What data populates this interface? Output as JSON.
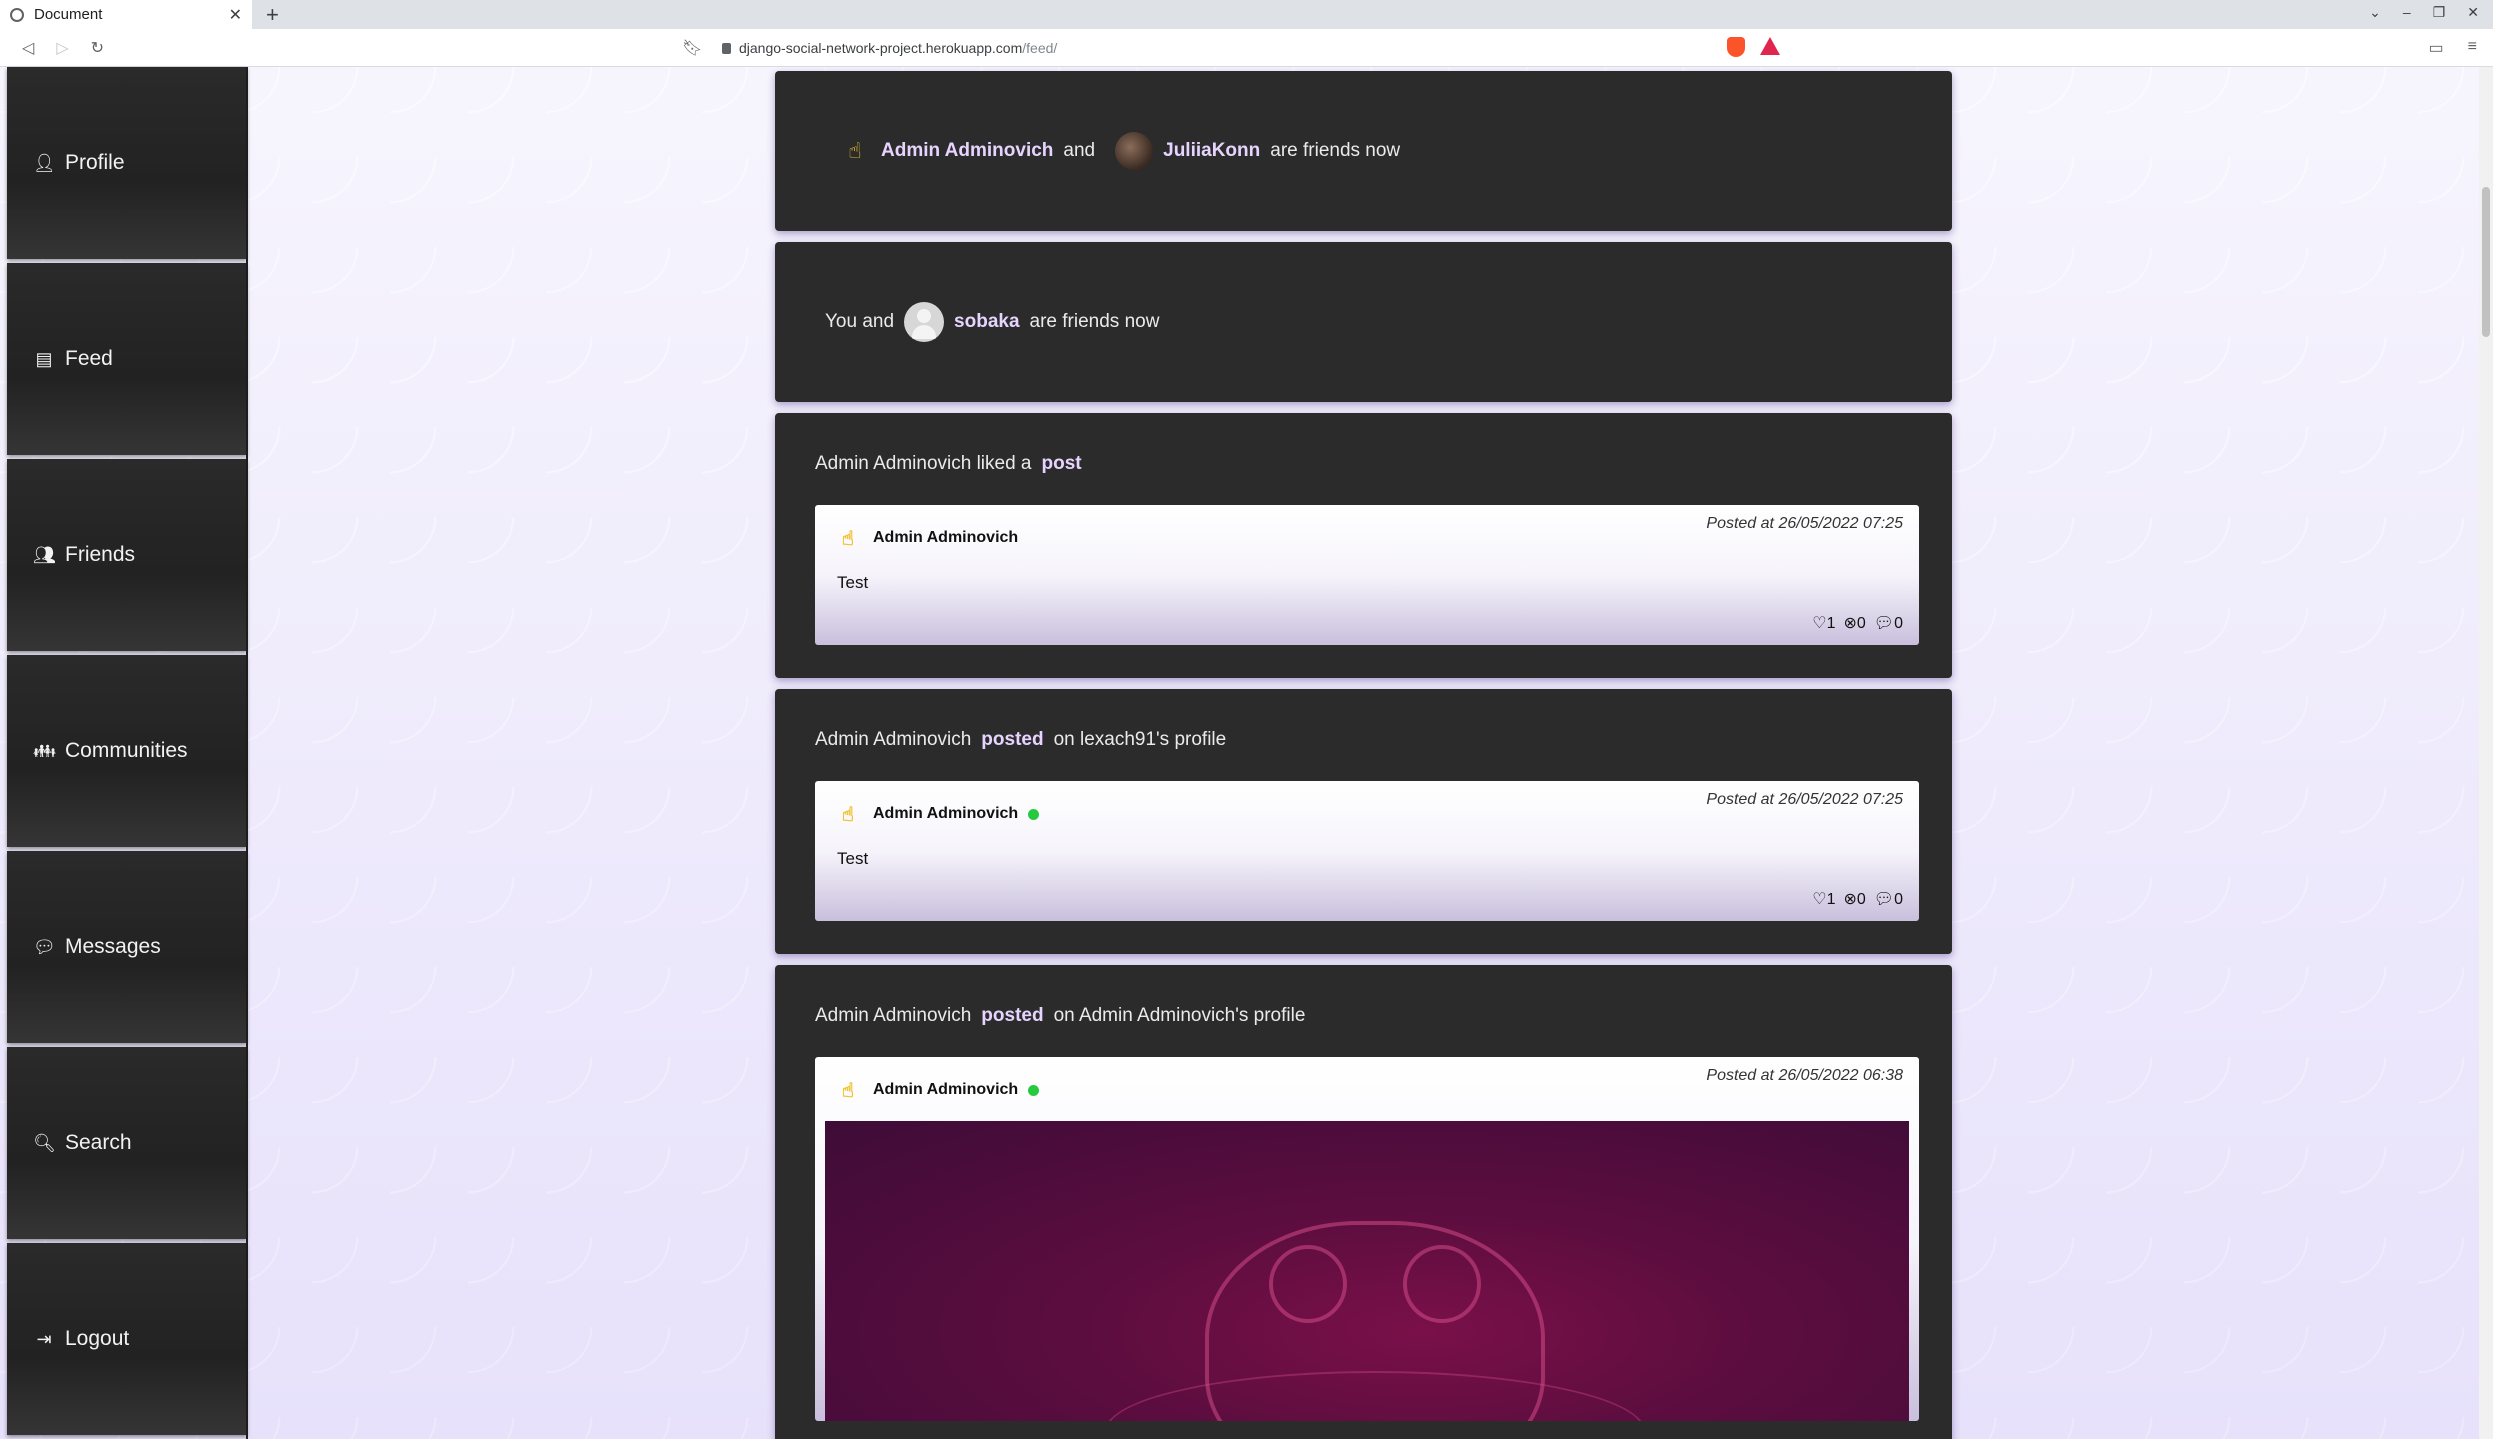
{
  "browser": {
    "tab_title": "Document",
    "url_host": "django-social-network-project.herokuapp.com",
    "url_path": "/feed/"
  },
  "sidebar": {
    "items": [
      {
        "label": "Profile",
        "icon": "user-icon"
      },
      {
        "label": "Feed",
        "icon": "newspaper-icon"
      },
      {
        "label": "Friends",
        "icon": "friends-icon"
      },
      {
        "label": "Communities",
        "icon": "communities-icon"
      },
      {
        "label": "Messages",
        "icon": "messages-icon"
      },
      {
        "label": "Search",
        "icon": "search-icon"
      },
      {
        "label": "Logout",
        "icon": "logout-icon"
      }
    ]
  },
  "feed": {
    "friendship1": {
      "user1": "Admin Adminovich",
      "and": "and",
      "user2": "JuliiaKonn",
      "suffix": "are friends now"
    },
    "friendship2": {
      "prefix": "You and",
      "user": "sobaka",
      "suffix": "are friends now"
    },
    "activity1": {
      "head_text": "Admin Adminovich liked a",
      "head_link": "post",
      "post": {
        "time": "Posted at 26/05/2022 07:25",
        "author": "Admin Adminovich",
        "text": "Test",
        "likes": "1",
        "dislikes": "0",
        "comments": "0"
      }
    },
    "activity2": {
      "head_name": "Admin Adminovich",
      "head_action": "posted",
      "head_suffix": "on lexach91's profile",
      "post": {
        "time": "Posted at 26/05/2022 07:25",
        "author": "Admin Adminovich",
        "text": "Test",
        "likes": "1",
        "dislikes": "0",
        "comments": "0"
      }
    },
    "activity3": {
      "head_name": "Admin Adminovich",
      "head_action": "posted",
      "head_suffix": "on Admin Adminovich's profile",
      "post": {
        "time": "Posted at 26/05/2022 06:38",
        "author": "Admin Adminovich"
      }
    }
  },
  "colors": {
    "card_bg": "#2b2b2b",
    "link": "#e6d4ff",
    "online": "#27c93f",
    "page_bg": "#ece8fb"
  }
}
